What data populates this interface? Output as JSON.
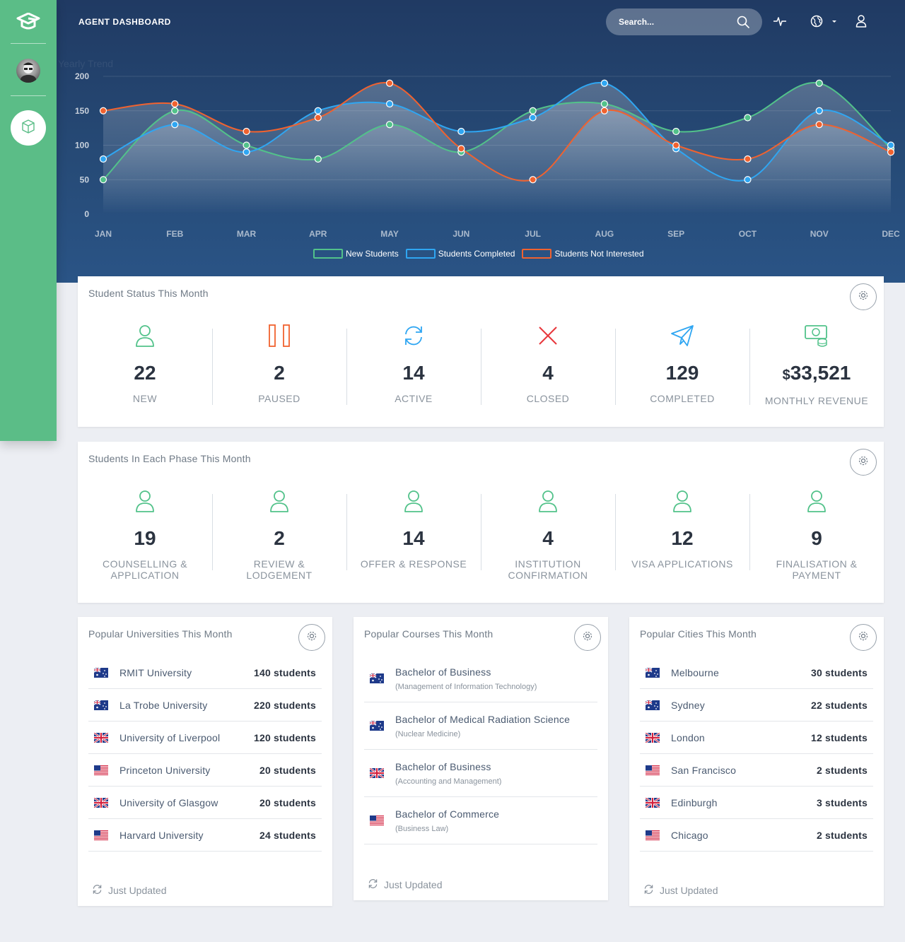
{
  "header": {
    "title": "AGENT DASHBOARD",
    "search_placeholder": "Search..."
  },
  "colors": {
    "sidebar": "#5bbd87",
    "green": "#52c28a",
    "blue": "#2fa6f2",
    "orange": "#f0622f"
  },
  "chart_data": {
    "type": "line",
    "title": "Yearly Trend",
    "categories": [
      "JAN",
      "FEB",
      "MAR",
      "APR",
      "MAY",
      "JUN",
      "JUL",
      "AUG",
      "SEP",
      "OCT",
      "NOV",
      "DEC"
    ],
    "ylim": [
      0,
      200
    ],
    "yticks": [
      0,
      50,
      100,
      150,
      200
    ],
    "grid": true,
    "legend_position": "bottom",
    "series": [
      {
        "name": "New Students",
        "color": "#52c28a",
        "values": [
          50,
          150,
          100,
          80,
          130,
          90,
          150,
          160,
          120,
          140,
          190,
          95
        ]
      },
      {
        "name": "Students Completed",
        "color": "#2fa6f2",
        "values": [
          80,
          130,
          90,
          150,
          160,
          120,
          140,
          190,
          95,
          50,
          150,
          100
        ]
      },
      {
        "name": "Students Not Interested",
        "color": "#f0622f",
        "values": [
          150,
          160,
          120,
          140,
          190,
          95,
          50,
          150,
          100,
          80,
          130,
          90
        ]
      }
    ]
  },
  "status_card": {
    "title": "Student Status This Month",
    "stats": [
      {
        "icon": "user-icon",
        "value": "22",
        "label": "NEW"
      },
      {
        "icon": "pause-icon",
        "value": "2",
        "label": "PAUSED"
      },
      {
        "icon": "refresh-icon",
        "value": "14",
        "label": "ACTIVE"
      },
      {
        "icon": "close-icon",
        "value": "4",
        "label": "CLOSED"
      },
      {
        "icon": "paper-plane-icon",
        "value": "129",
        "label": "COMPLETED"
      },
      {
        "icon": "money-icon",
        "currency": "$",
        "value": "33,521",
        "label": "MONTHLY REVENUE"
      }
    ]
  },
  "phase_card": {
    "title": "Students In Each Phase This Month",
    "stats": [
      {
        "value": "19",
        "label_1": "COUNSELLING &",
        "label_2": "APPLICATION"
      },
      {
        "value": "2",
        "label_1": "REVIEW &",
        "label_2": "LODGEMENT"
      },
      {
        "value": "14",
        "label_1": "OFFER & RESPONSE",
        "label_2": ""
      },
      {
        "value": "4",
        "label_1": "INSTITUTION",
        "label_2": "CONFIRMATION"
      },
      {
        "value": "12",
        "label_1": "VISA APPLICATIONS",
        "label_2": ""
      },
      {
        "value": "9",
        "label_1": "FINALISATION &",
        "label_2": "PAYMENT"
      }
    ]
  },
  "universities": {
    "title": "Popular Universities This Month",
    "rows": [
      {
        "flag": "au",
        "name": "RMIT University",
        "value": "140 students"
      },
      {
        "flag": "au",
        "name": "La Trobe University",
        "value": "220 students"
      },
      {
        "flag": "uk",
        "name": "University of Liverpool",
        "value": "120 students"
      },
      {
        "flag": "us",
        "name": "Princeton University",
        "value": "20 students"
      },
      {
        "flag": "uk",
        "name": "University of Glasgow",
        "value": "20 students"
      },
      {
        "flag": "us",
        "name": "Harvard University",
        "value": "24 students"
      }
    ],
    "footer": "Just Updated"
  },
  "courses": {
    "title": "Popular Courses This Month",
    "rows": [
      {
        "flag": "au",
        "name": "Bachelor of Business",
        "sub": "(Management of Information Technology)"
      },
      {
        "flag": "au",
        "name": "Bachelor of Medical Radiation Science",
        "sub": "(Nuclear Medicine)"
      },
      {
        "flag": "uk",
        "name": "Bachelor of Business",
        "sub": "(Accounting and Management)"
      },
      {
        "flag": "us",
        "name": "Bachelor of Commerce",
        "sub": "(Business Law)"
      }
    ],
    "footer": "Just Updated"
  },
  "cities": {
    "title": "Popular Cities This Month",
    "rows": [
      {
        "flag": "au",
        "name": "Melbourne",
        "value": "30 students"
      },
      {
        "flag": "au",
        "name": "Sydney",
        "value": "22 students"
      },
      {
        "flag": "uk",
        "name": "London",
        "value": "12 students"
      },
      {
        "flag": "us",
        "name": "San Francisco",
        "value": "2 students"
      },
      {
        "flag": "uk",
        "name": "Edinburgh",
        "value": "3 students"
      },
      {
        "flag": "us",
        "name": "Chicago",
        "value": "2 students"
      }
    ],
    "footer": "Just Updated"
  }
}
